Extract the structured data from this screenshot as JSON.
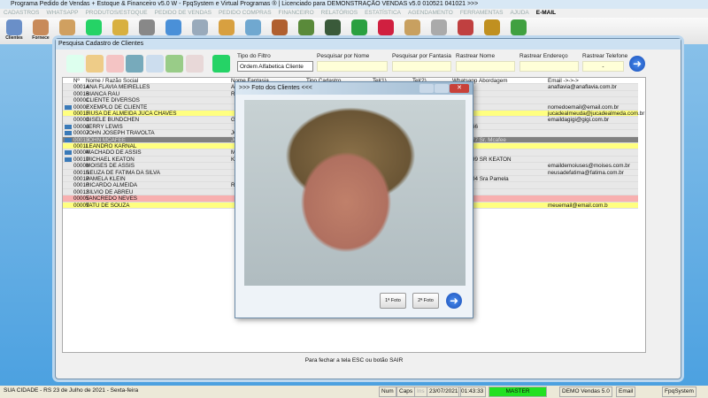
{
  "app": {
    "title": "Programa Pedido de Vendas + Estoque & Financeiro v5.0 W - FpqSystem e Virtual Programas ® | Licenciado para  DEMONSTRAÇÃO VENDAS v5.0 010521 041021 >>>"
  },
  "menu": [
    "CADASTROS",
    "WHATSAPP",
    "PRODUTOS/ESTOQUE",
    "PEDIDO DE VENDAS",
    "PEDIDO COMPRAS",
    "FINANCEIRO",
    "RELATÓRIOS",
    "ESTATÍSTICA",
    "AGENDAMENTO",
    "FERRAMENTAS",
    "AJUDA",
    "E-MAIL"
  ],
  "toolbar": [
    {
      "label": "Clientes",
      "color": "#6a8fc8"
    },
    {
      "label": "Fornece",
      "color": "#c88a5a"
    },
    {
      "label": "",
      "color": "#d0a060"
    },
    {
      "label": "",
      "color": "#25d366"
    },
    {
      "label": "",
      "color": "#d8b040"
    },
    {
      "label": "",
      "color": "#888"
    },
    {
      "label": "",
      "color": "#4a90d8"
    },
    {
      "label": "",
      "color": "#9ab"
    },
    {
      "label": "",
      "color": "#d8a040"
    },
    {
      "label": "",
      "color": "#70a8d0"
    },
    {
      "label": "",
      "color": "#b06030"
    },
    {
      "label": "",
      "color": "#5a8a3a"
    },
    {
      "label": "",
      "color": "#3a5a3a"
    },
    {
      "label": "",
      "color": "#2aa040"
    },
    {
      "label": "",
      "color": "#d02040"
    },
    {
      "label": "",
      "color": "#c8a060"
    },
    {
      "label": "",
      "color": "#aaa"
    },
    {
      "label": "",
      "color": "#c04040"
    },
    {
      "label": "",
      "color": "#c09020"
    },
    {
      "label": "",
      "color": "#40a040"
    }
  ],
  "window": {
    "title": "Pesquisa Cadastro de Clientes",
    "footer": "Para fechar a tela ESC ou botão SAIR"
  },
  "filters": {
    "tipo_label": "Tipo do Filtro",
    "tipo_value": "Ordem Alfabetica Cliente",
    "nome_label": "Pesquisar por Nome",
    "fantasia_label": "Pesquisar por Fantasia",
    "rastrear_nome_label": "Rastrear Nome",
    "rastrear_endereco_label": "Rastrear Endereço",
    "rastrear_telefone_label": "Rastrear Telefone",
    "rastrear_telefone_value": "-"
  },
  "columns": [
    "Nº",
    "Nome / Razão Social",
    "Nome Fantasia",
    "Tipo Cadastro",
    "Tel(1)",
    "Tel(2)",
    "Whatsapp",
    "Abordagem",
    "Email ->->->"
  ],
  "rows": [
    {
      "n": "00014",
      "nome": "ANA FLAVIA MEIRELLES",
      "fant": "Al",
      "abord": "",
      "email": "anaflavia@anaflavia.com.br",
      "color": "#e8e8e8",
      "icon": false
    },
    {
      "n": "00016",
      "nome": "BIANCA RAU",
      "fant": "Ri",
      "abord": "",
      "email": "",
      "color": "#e8e8e8",
      "icon": false
    },
    {
      "n": "00001",
      "nome": "CLIENTE DIVERSOS",
      "fant": "",
      "abord": "",
      "email": "",
      "color": "#e8e8e8",
      "icon": false
    },
    {
      "n": "00002",
      "nome": "EXEMPLO DE CLIENTE",
      "fant": "",
      "abord": "",
      "email": "nomedoemail@email.com.br",
      "color": "#e8e8e8",
      "icon": true
    },
    {
      "n": "00013",
      "nome": "FIUSA DE ALMEIDA JUCA CHAVES",
      "fant": "",
      "abord": "",
      "email": "jucadealmeuda@jucadealmeda.com.br",
      "color": "#ffff80",
      "icon": false
    },
    {
      "n": "00003",
      "nome": "GISELE BUNDCHEN",
      "fant": "Gi",
      "abord": "",
      "email": "emaildagigi@gigi.com.br",
      "color": "#e8e8e8",
      "icon": false
    },
    {
      "n": "00006",
      "nome": "JERRY LEWIS",
      "fant": "",
      "abord": "66",
      "email": "",
      "color": "#e8e8e8",
      "icon": true
    },
    {
      "n": "00007",
      "nome": "JOHN JOSEPH TRAVOLTA",
      "fant": "JO",
      "abord": "",
      "email": "",
      "color": "#e8e8e8",
      "icon": true
    },
    {
      "n": "00015",
      "nome": "JOHN MCAFEE",
      "fant": "JO",
      "abord": "77  Sr. Mcafee",
      "email": "",
      "color": "#808080",
      "icon": true
    },
    {
      "n": "00011",
      "nome": "LEANDRO KARNAL",
      "fant": "",
      "abord": "",
      "email": "",
      "color": "#ffff80",
      "icon": false
    },
    {
      "n": "00004",
      "nome": "MACHADO DE ASSIS",
      "fant": "M",
      "abord": "",
      "email": "",
      "color": "#e8e8e8",
      "icon": true
    },
    {
      "n": "00017",
      "nome": "MICHAEL KEATON",
      "fant": "K",
      "abord": "99  SR KEATON",
      "email": "",
      "color": "#e8e8e8",
      "icon": true
    },
    {
      "n": "00008",
      "nome": "MOISES DE ASSIS",
      "fant": "",
      "abord": "",
      "email": "emaildemoiuses@moises.com.br",
      "color": "#e8e8e8",
      "icon": false
    },
    {
      "n": "00015",
      "nome": "NEUZA DE FATIMA DA SILVA",
      "fant": "",
      "abord": "",
      "email": "neusadefatima@fatima.com.br",
      "color": "#e8e8e8",
      "icon": false
    },
    {
      "n": "00018",
      "nome": "PAMELA KLEIN",
      "fant": "",
      "abord": "04  Sra Pamela",
      "email": "",
      "color": "#e8e8e8",
      "icon": false
    },
    {
      "n": "00010",
      "nome": "RICARDO ALMEIDA",
      "fant": "Ri",
      "abord": "",
      "email": "",
      "color": "#e8e8e8",
      "icon": false
    },
    {
      "n": "00012",
      "nome": "SILVIO DE ABREU",
      "fant": "",
      "abord": "",
      "email": "",
      "color": "#e8e8e8",
      "icon": false
    },
    {
      "n": "00005",
      "nome": "TANCREDO NEVES",
      "fant": "",
      "abord": "",
      "email": "",
      "color": "#f8b0b0",
      "icon": false
    },
    {
      "n": "00009",
      "nome": "TATU DE SOUZA",
      "fant": "",
      "abord": "",
      "email": "meuemail@email.com.b",
      "color": "#ffff80",
      "icon": false
    }
  ],
  "photo_dialog": {
    "title": ">>> Foto dos Clientes <<<",
    "btn1": "1ª Foto",
    "btn2": "2ª Foto"
  },
  "status": {
    "city": "SUA CIDADE - RS 23 de Julho de 2021 - Sexta-feira",
    "num": "Num",
    "caps": "Caps",
    "ins": "Ins",
    "date": "23/07/2021",
    "time": "01:43:33",
    "user": "MASTER",
    "version": "DEMO Vendas 5.0",
    "email": "Email",
    "company": "FpqSystem"
  }
}
